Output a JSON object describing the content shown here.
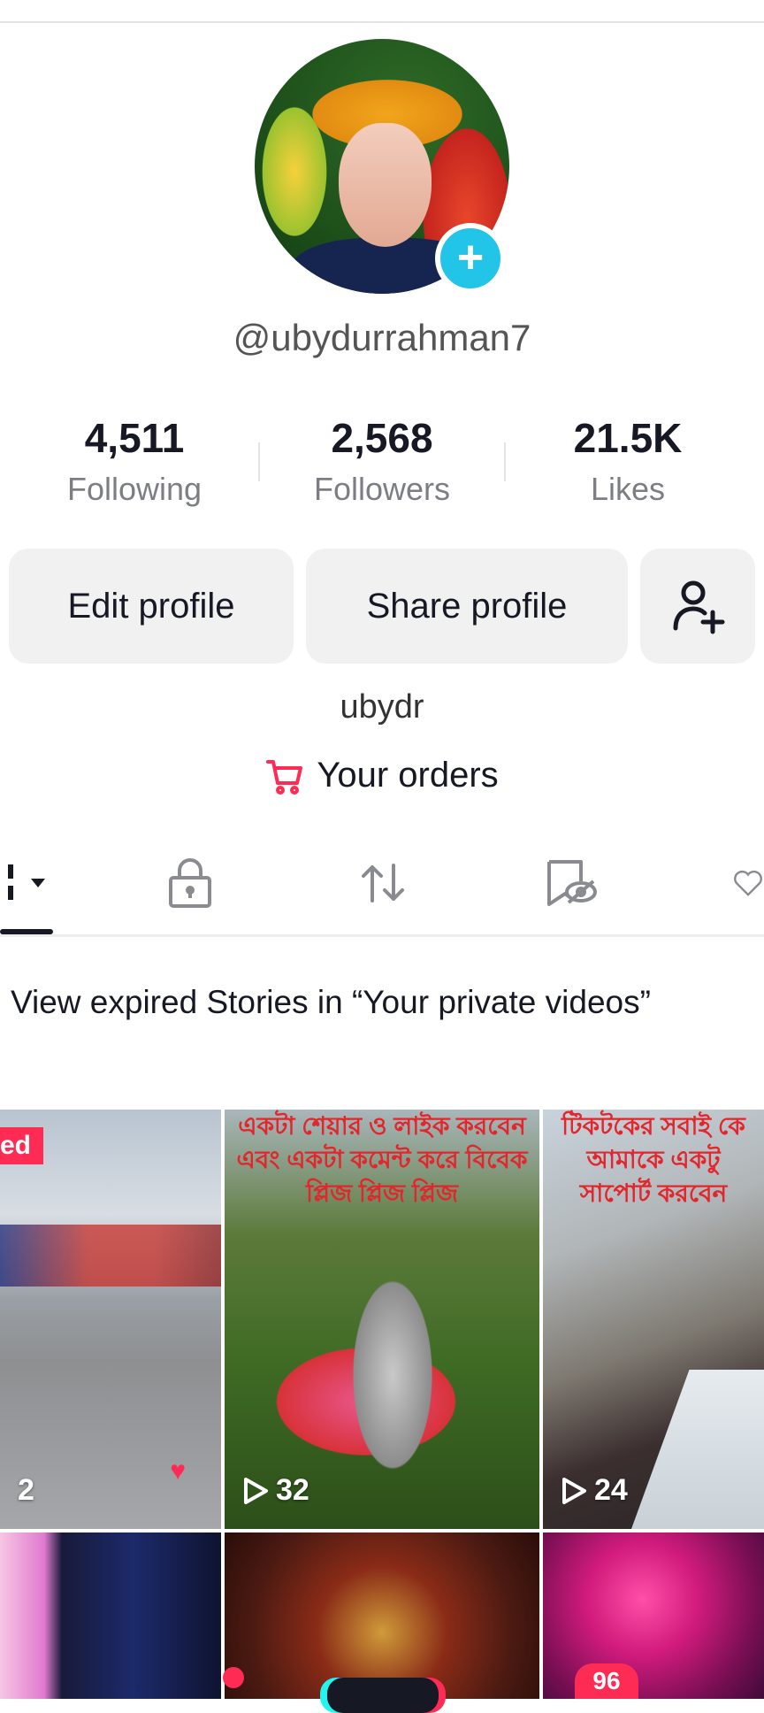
{
  "profile": {
    "username": "@ubydurrahman7",
    "bio": "ubydr",
    "stats": {
      "following_count": "4,511",
      "following_label": "Following",
      "followers_count": "2,568",
      "followers_label": "Followers",
      "likes_count": "21.5K",
      "likes_label": "Likes"
    }
  },
  "actions": {
    "edit_label": "Edit profile",
    "share_label": "Share profile",
    "add_friend_icon": "person-plus-icon"
  },
  "orders_label": "Your orders",
  "tabs": [
    {
      "icon": "grid-videos-icon",
      "active": true
    },
    {
      "icon": "lock-icon"
    },
    {
      "icon": "repost-icon"
    },
    {
      "icon": "favorites-icon"
    },
    {
      "icon": "liked-icon"
    }
  ],
  "notice": "View expired Stories in “Your private videos”",
  "videos": [
    {
      "count": "2",
      "tag": "ed"
    },
    {
      "count": "32",
      "overlay": "একটা শেয়ার ও লাইক করবেন এবং একটা কমেন্ট করে বিবেক প্লিজ প্লিজ প্লিজ"
    },
    {
      "count": "24",
      "overlay": "টিকটকের সবাই কে আমাকে একটু সাপোর্ট করবেন"
    },
    {
      "count": ""
    },
    {
      "count": ""
    },
    {
      "count": ""
    }
  ],
  "bottom_nav": {
    "inbox_badge": "96"
  },
  "colors": {
    "accent": "#fe2c55",
    "plus": "#22c5e8",
    "button_bg": "#f1f1f2"
  }
}
